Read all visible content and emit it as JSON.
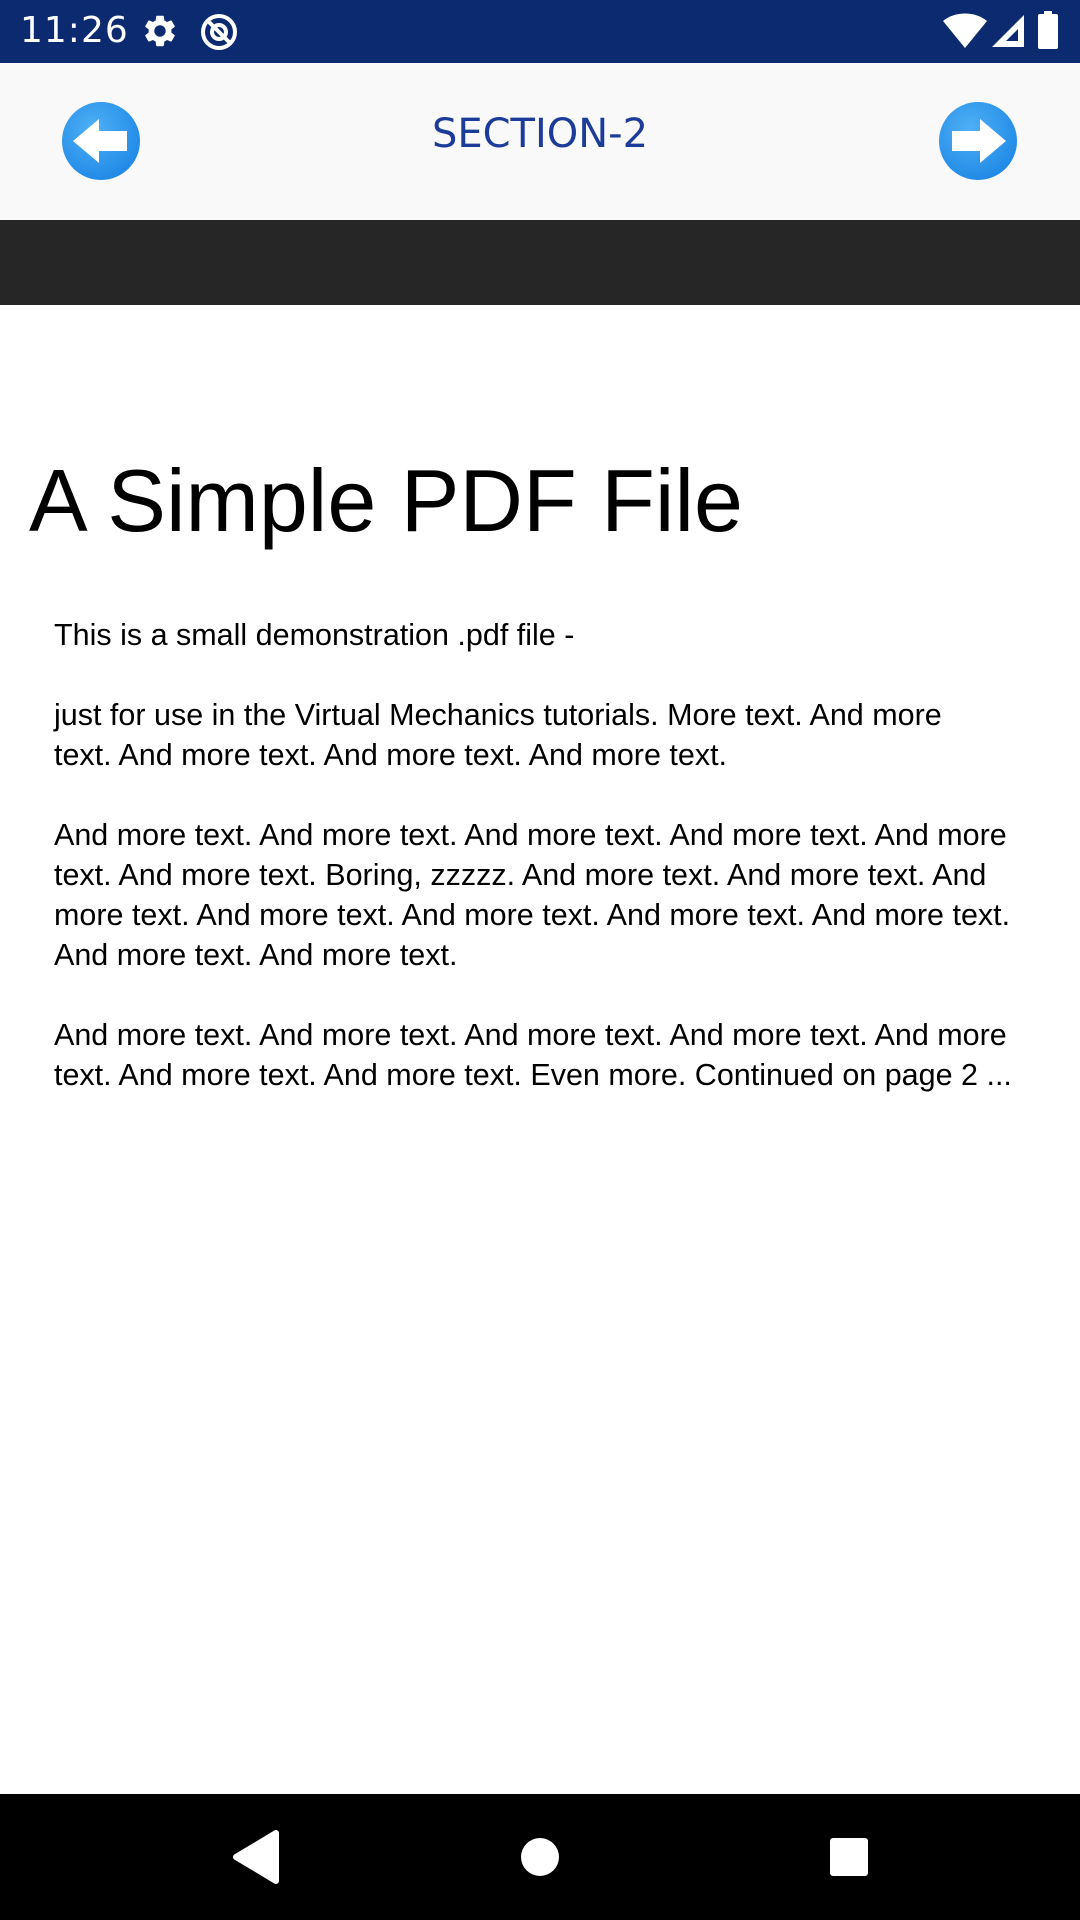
{
  "status_bar": {
    "time": "11:26",
    "left_icons": [
      "gear-icon",
      "at-sign-icon"
    ],
    "right_icons": [
      "wifi-icon",
      "cell-signal-icon",
      "battery-icon"
    ],
    "background": "#0b2a6f"
  },
  "header": {
    "title": "SECTION-2",
    "back_icon": "arrow-left-icon",
    "forward_icon": "arrow-right-icon",
    "title_color": "#1c3c9a",
    "button_color": "#1e88e5"
  },
  "document": {
    "title": "A Simple PDF File",
    "paragraphs": [
      {
        "lines": [
          "This is a small demonstration .pdf file -"
        ]
      },
      {
        "lines": [
          "just for use in the Virtual Mechanics tutorials. More text. And more",
          "text. And more text. And more text. And more text."
        ]
      },
      {
        "lines": [
          "And more text. And more text. And more text. And more text. And more",
          "text. And more text. Boring, zzzzz. And more text. And more text. And",
          "more text. And more text. And more text. And more text. And more text.",
          "And more text. And more text."
        ]
      },
      {
        "lines": [
          "And more text. And more text. And more text. And more text. And more",
          "text. And more text. And more text. Even more. Continued on page 2 ..."
        ]
      }
    ]
  },
  "system_nav": {
    "buttons": [
      "back-triangle-icon",
      "home-circle-icon",
      "recents-square-icon"
    ]
  }
}
